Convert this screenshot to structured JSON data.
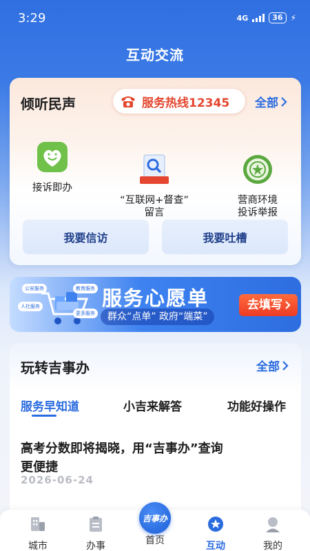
{
  "status_bar": {
    "time": "3:29",
    "network": "4G",
    "battery": "36"
  },
  "header": {
    "title": "互动交流"
  },
  "voice_card": {
    "title": "倾听民声",
    "hotline_label": "服务热线12345",
    "more_label": "全部",
    "services": [
      {
        "label": "接诉即办",
        "icon": "heart-face-icon"
      },
      {
        "label": "“互联网+督查”\n留言",
        "icon": "search-doc-icon",
        "badge": "互联网+督查"
      },
      {
        "label": "营商环境\n投诉举报",
        "icon": "emblem-icon"
      }
    ],
    "buttons": [
      "我要信访",
      "我要吐槽"
    ]
  },
  "banner": {
    "title": "服务心愿单",
    "subtitle": "群众“点单” 政府“端菜”",
    "cta": "去填写",
    "tags": [
      "公安服务",
      "教育服务",
      "人社服务",
      "更多服务"
    ]
  },
  "fun_card": {
    "title": "玩转吉事办",
    "more_label": "全部",
    "tabs": [
      {
        "label": "服务早知道",
        "active": true
      },
      {
        "label": "小吉来解答",
        "active": false
      },
      {
        "label": "功能好操作",
        "active": false
      }
    ],
    "news": {
      "title": "高考分数即将揭晓，用“吉事办”查询更便捷",
      "date": "2026-06-24"
    }
  },
  "bottom_nav": {
    "items": [
      {
        "label": "城市",
        "icon": "city-icon",
        "active": false
      },
      {
        "label": "办事",
        "icon": "clipboard-icon",
        "active": false
      },
      {
        "label": "首页",
        "icon": "home-logo-icon",
        "active": false
      },
      {
        "label": "互动",
        "icon": "star-chat-icon",
        "active": true
      },
      {
        "label": "我的",
        "icon": "user-icon",
        "active": false
      }
    ],
    "center_logo": "吉事办"
  },
  "colors": {
    "primary": "#2a6be0",
    "hotline_red": "#e4462f",
    "cta_orange": "#ee3b24"
  }
}
